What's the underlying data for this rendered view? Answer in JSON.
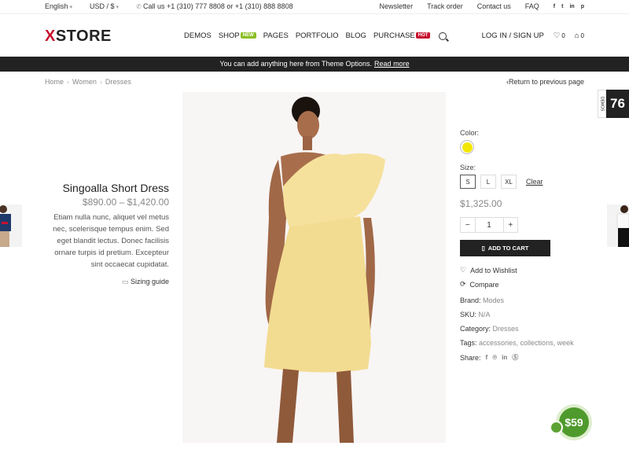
{
  "topbar": {
    "language": "English",
    "currency": "USD / $",
    "call": "Call us +1 (310) 777 8808 or +1 (310) 888 8808",
    "links": [
      "Newsletter",
      "Track order",
      "Contact us",
      "FAQ"
    ],
    "socials": [
      "f",
      "t",
      "in",
      "p"
    ]
  },
  "header": {
    "logo_x": "X",
    "logo_text": "STORE",
    "nav": {
      "demos": "DEMOS",
      "shop": "SHOP",
      "shop_badge": "NEW",
      "pages": "PAGES",
      "portfolio": "PORTFOLIO",
      "blog": "BLOG",
      "purchase": "PURCHASE",
      "purchase_badge": "HOT"
    },
    "account": "LOG IN / SIGN UP",
    "wishlist_count": "0",
    "cart_count": "0"
  },
  "promo": {
    "text": "You can add anything here from Theme Options.",
    "link": "Read more"
  },
  "breadcrumb": [
    "Home",
    "Women",
    "Dresses"
  ],
  "return_link": "Return to previous page",
  "demos_tab": {
    "label": "DEMOS",
    "count": "76"
  },
  "product": {
    "title": "Singoalla Short Dress",
    "price_range": "$890.00 – $1,420.00",
    "description": "Etiam nulla nunc, aliquet vel metus nec, scelerisque tempus enim. Sed eget blandit lectus. Donec facilisis ornare turpis id pretium. Excepteur sint occaecat cupidatat.",
    "sizing_guide": "Sizing guide",
    "color_label": "Color:",
    "color_value": "#f2e600",
    "size_label": "Size:",
    "sizes": [
      "S",
      "L",
      "XL"
    ],
    "clear": "Clear",
    "price": "$1,325.00",
    "qty": "1",
    "add_to_cart": "ADD TO CART",
    "wishlist": "Add to Wishlist",
    "compare": "Compare",
    "brand_label": "Brand:",
    "brand": "Modes",
    "sku_label": "SKU:",
    "sku": "N/A",
    "category_label": "Category:",
    "category": "Dresses",
    "tags_label": "Tags:",
    "tags": "accessories, collections, week",
    "share_label": "Share:"
  },
  "float_badge": "$59"
}
